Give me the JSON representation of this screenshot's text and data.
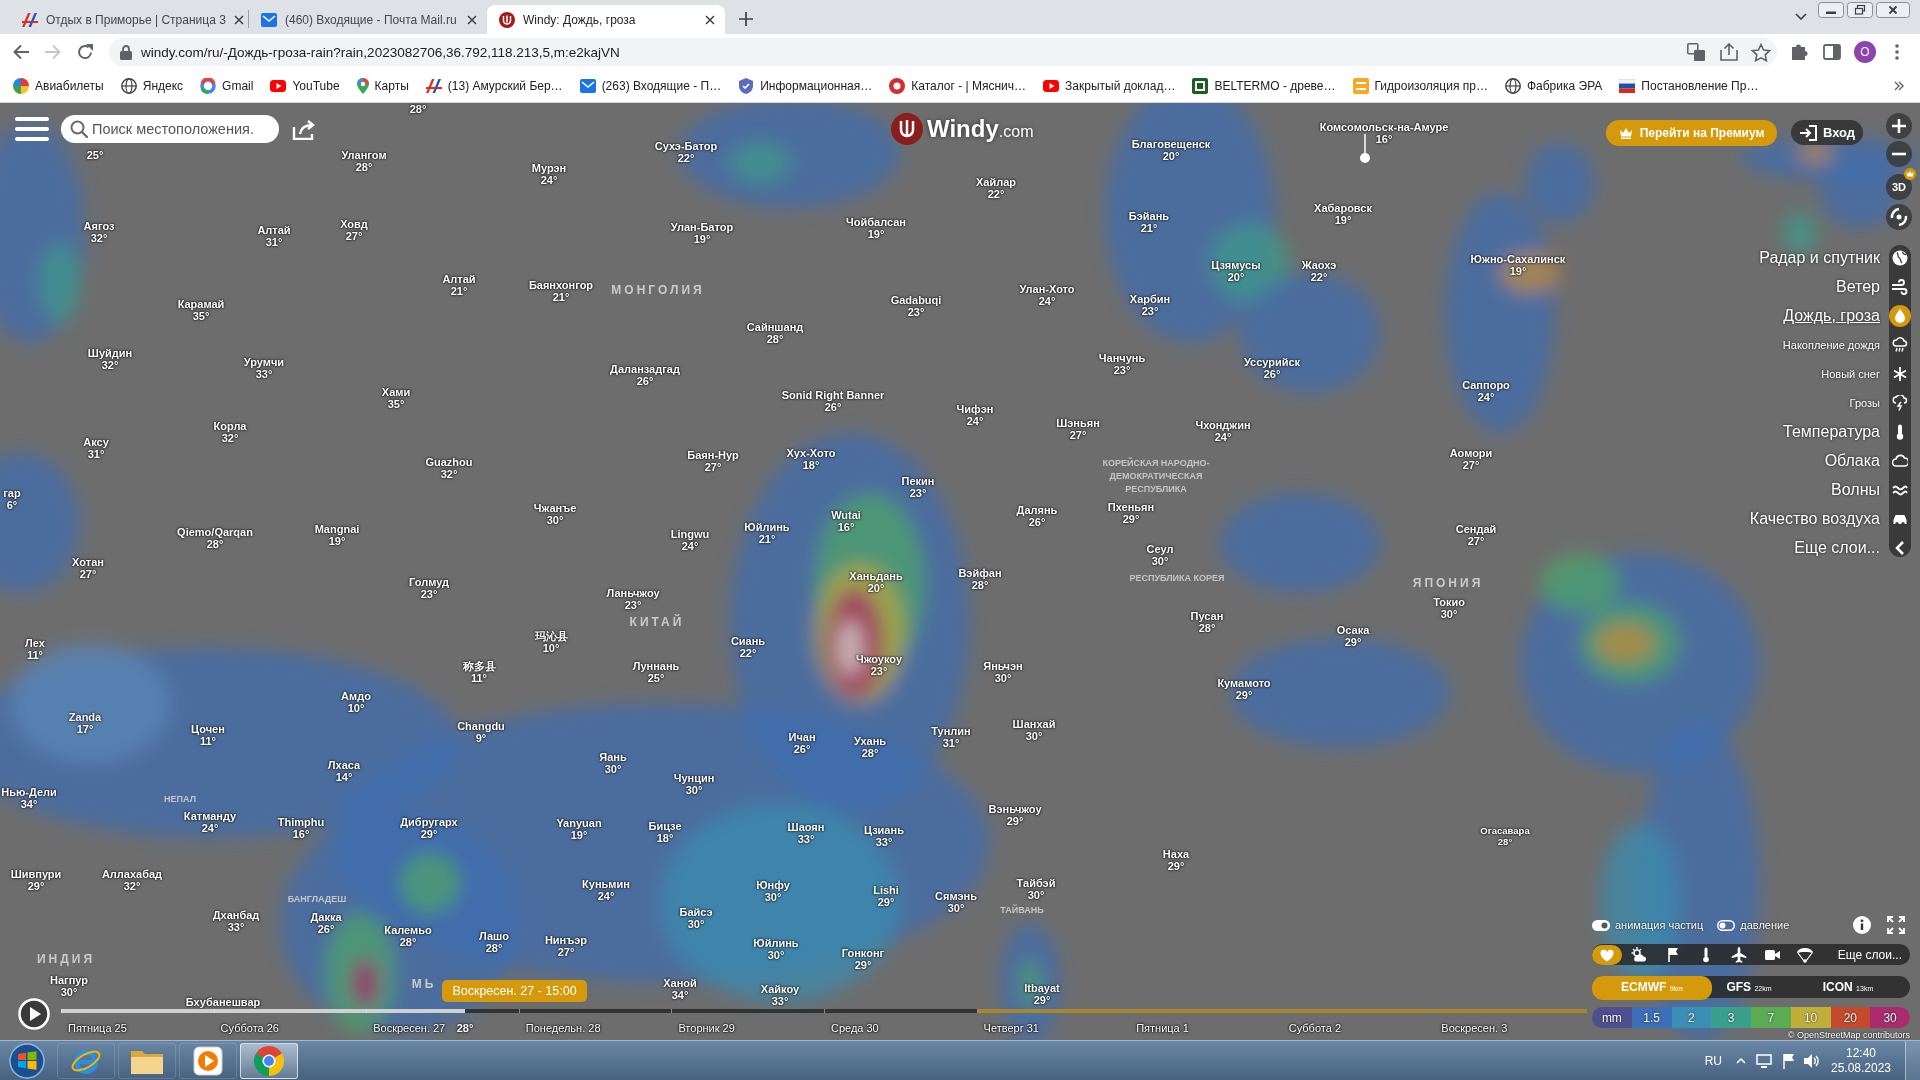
{
  "tabs": [
    {
      "title": "Отдых в Приморье | Страница 3",
      "selected": false
    },
    {
      "title": "(460) Входящие - Почта Mail.ru",
      "selected": false
    },
    {
      "title": "Windy: Дождь, гроза",
      "selected": true
    }
  ],
  "address_bar": {
    "url": "windy.com/ru/-Дождь-гроза-rain?rain,2023082706,36.792,118.213,5,m:e2kajVN",
    "forward_disabled": true,
    "profile_initial": "О"
  },
  "bookmarks": [
    "Авиабилеты",
    "Яндекс",
    "Gmail",
    "YouTube",
    "Карты",
    "(13) Амурский Бер…",
    "(263) Входящие - П…",
    "Информационная…",
    "Каталог - | Мяснич…",
    "Закрытый доклад…",
    "BELTERMO - древе…",
    "Гидроизоляция пр…",
    "Фабрика ЭРА",
    "Постановление Пр…"
  ],
  "map": {
    "search": {
      "placeholder": "Поиск местоположения."
    },
    "logo": {
      "name": "Windy",
      "suffix": ".com"
    },
    "premium_button": "Перейти на Премиум",
    "login_button": "Вход",
    "view_button": "3D",
    "labels": [
      {
        "kind": "city",
        "temp": "28°"
      },
      {
        "kind": "city",
        "name": "Комсомольск-на-Амуре",
        "temp": "16°"
      },
      {
        "kind": "city",
        "temp": "25°"
      },
      {
        "kind": "city",
        "name": "Улангом",
        "temp": "28°"
      },
      {
        "kind": "city",
        "name": "Сухэ-Батор",
        "temp": "22°"
      },
      {
        "kind": "city",
        "name": "Благовещенск",
        "temp": "20°"
      },
      {
        "kind": "city",
        "name": "Мурэн",
        "temp": "24°"
      },
      {
        "kind": "city",
        "name": "Хайлар",
        "temp": "22°"
      },
      {
        "kind": "city",
        "name": "Хабаровск",
        "temp": "19°"
      },
      {
        "kind": "city",
        "name": "Аягоз",
        "temp": "32°"
      },
      {
        "kind": "city",
        "name": "Алтай",
        "temp": "31°"
      },
      {
        "kind": "city",
        "name": "Ховд",
        "temp": "27°"
      },
      {
        "kind": "city",
        "name": "Улан-Батор",
        "temp": "19°"
      },
      {
        "kind": "city",
        "name": "Чойбалсан",
        "temp": "19°"
      },
      {
        "kind": "city",
        "name": "Бэйань",
        "temp": "21°"
      },
      {
        "kind": "city",
        "name": "Цзямусы",
        "temp": "20°"
      },
      {
        "kind": "city",
        "name": "Жаохэ",
        "temp": "22°"
      },
      {
        "kind": "city",
        "name": "Южно-Сахалинск",
        "temp": "19°"
      },
      {
        "kind": "city",
        "name": "Алтай",
        "temp": "21°"
      },
      {
        "kind": "city",
        "name": "Баянхонгор",
        "temp": "21°"
      },
      {
        "kind": "country",
        "name": "МОНГОЛИЯ"
      },
      {
        "kind": "city",
        "name": "Улан-Хото",
        "temp": "24°"
      },
      {
        "kind": "city",
        "name": "Карамай",
        "temp": "35°"
      },
      {
        "kind": "city",
        "name": "Gadabuqi",
        "temp": "23°"
      },
      {
        "kind": "city",
        "name": "Харбин",
        "temp": "23°"
      },
      {
        "kind": "city",
        "name": "Сайншанд",
        "temp": "28°"
      },
      {
        "kind": "city",
        "name": "Шуйдин",
        "temp": "32°"
      },
      {
        "kind": "city",
        "name": "Урумчи",
        "temp": "33°"
      },
      {
        "kind": "city",
        "name": "Даланзадгад",
        "temp": "26°"
      },
      {
        "kind": "city",
        "name": "Чанчунь",
        "temp": "23°"
      },
      {
        "kind": "city",
        "name": "Уссурийск",
        "temp": "26°"
      },
      {
        "kind": "city",
        "name": "Хами",
        "temp": "35°"
      },
      {
        "kind": "city",
        "name": "Sonid Right Banner",
        "temp": "26°"
      },
      {
        "kind": "city",
        "name": "Саппоро",
        "temp": "24°"
      },
      {
        "kind": "city",
        "name": "Чифэн",
        "temp": "24°"
      },
      {
        "kind": "city",
        "name": "Корла",
        "temp": "32°"
      },
      {
        "kind": "city",
        "name": "Шэньян",
        "temp": "27°"
      },
      {
        "kind": "city",
        "name": "Чхонджин",
        "temp": "24°"
      },
      {
        "kind": "city",
        "name": "Аксу",
        "temp": "31°"
      },
      {
        "kind": "city",
        "name": "Guazhou",
        "temp": "32°"
      },
      {
        "kind": "city",
        "name": "Баян-Нур",
        "temp": "27°"
      },
      {
        "kind": "city",
        "name": "Хух-Хото",
        "temp": "18°"
      },
      {
        "kind": "city",
        "name": "гар",
        "temp": "6°"
      },
      {
        "kind": "city",
        "name": "Пекин",
        "temp": "23°"
      },
      {
        "kind": "region",
        "name": "КОРЕЙСКАЯ НАРОДНО-ДЕМОКРАТИЧЕСКАЯ РЕСПУБЛИКА"
      },
      {
        "kind": "city",
        "name": "Аомори",
        "temp": "27°"
      },
      {
        "kind": "city",
        "name": "Чжанъе",
        "temp": "30°"
      },
      {
        "kind": "city",
        "name": "Wutai",
        "temp": "16°"
      },
      {
        "kind": "city",
        "name": "Далянь",
        "temp": "26°"
      },
      {
        "kind": "city",
        "name": "Пхеньян",
        "temp": "29°"
      },
      {
        "kind": "city",
        "name": "Qiemo/Qarqan",
        "temp": "28°"
      },
      {
        "kind": "city",
        "name": "Mangnai",
        "temp": "19°"
      },
      {
        "kind": "city",
        "name": "Lingwu",
        "temp": "24°"
      },
      {
        "kind": "city",
        "name": "Юйлинь",
        "temp": "21°"
      },
      {
        "kind": "city",
        "name": "Сендай",
        "temp": "27°"
      },
      {
        "kind": "city",
        "name": "Хотан",
        "temp": "27°"
      },
      {
        "kind": "city",
        "name": "Сеул",
        "temp": "30°"
      },
      {
        "kind": "city",
        "name": "Голмуд",
        "temp": "23°"
      },
      {
        "kind": "city",
        "name": "Ханьдань",
        "temp": "20°"
      },
      {
        "kind": "city",
        "name": "Вэйфан",
        "temp": "28°"
      },
      {
        "kind": "region",
        "name": "РЕСПУБЛИКА КОРЕЯ"
      },
      {
        "kind": "country",
        "name": "ЯПОНИЯ"
      },
      {
        "kind": "city",
        "name": "Ланьчжоу",
        "temp": "23°"
      },
      {
        "kind": "city",
        "name": "Токио",
        "temp": "30°"
      },
      {
        "kind": "city",
        "name": "Лех",
        "temp": "11°"
      },
      {
        "kind": "city",
        "name": "玛沁县",
        "temp": "10°"
      },
      {
        "kind": "country",
        "name": "КИТАЙ"
      },
      {
        "kind": "city",
        "name": "Сиань",
        "temp": "22°"
      },
      {
        "kind": "city",
        "name": "Пусан",
        "temp": "28°"
      },
      {
        "kind": "city",
        "name": "Осака",
        "temp": "29°"
      },
      {
        "kind": "city",
        "name": "称多县",
        "temp": "11°"
      },
      {
        "kind": "city",
        "name": "Луннань",
        "temp": "25°"
      },
      {
        "kind": "city",
        "name": "Чжоукоу",
        "temp": "23°"
      },
      {
        "kind": "city",
        "name": "Яньчэн",
        "temp": "30°"
      },
      {
        "kind": "city",
        "name": "Амдо",
        "temp": "10°"
      },
      {
        "kind": "city",
        "name": "Кумамото",
        "temp": "29°"
      },
      {
        "kind": "city",
        "name": "Zanda",
        "temp": "17°"
      },
      {
        "kind": "city",
        "name": "Цочен",
        "temp": "11°"
      },
      {
        "kind": "city",
        "name": "Changdu",
        "temp": "9°"
      },
      {
        "kind": "city",
        "name": "Ичан",
        "temp": "26°"
      },
      {
        "kind": "city",
        "name": "Ухань",
        "temp": "28°"
      },
      {
        "kind": "city",
        "name": "Тунлин",
        "temp": "31°"
      },
      {
        "kind": "city",
        "name": "Шанхай",
        "temp": "30°"
      },
      {
        "kind": "city",
        "name": "Лхаса",
        "temp": "14°"
      },
      {
        "kind": "city",
        "name": "Яань",
        "temp": "30°"
      },
      {
        "kind": "city",
        "name": "Нью-Дели",
        "temp": "34°"
      },
      {
        "kind": "region",
        "name": "НЕПАЛ"
      },
      {
        "kind": "city",
        "name": "Чунцин",
        "temp": "30°"
      },
      {
        "kind": "city",
        "name": "Катманду",
        "temp": "24°"
      },
      {
        "kind": "city",
        "name": "Thimphu",
        "temp": "16°"
      },
      {
        "kind": "city",
        "name": "Дибругарх",
        "temp": "29°"
      },
      {
        "kind": "city",
        "name": "Yanyuan",
        "temp": "19°"
      },
      {
        "kind": "city",
        "name": "Бицзе",
        "temp": "18°"
      },
      {
        "kind": "city",
        "name": "Шаоян",
        "temp": "33°"
      },
      {
        "kind": "city",
        "name": "Цзиань",
        "temp": "33°"
      },
      {
        "kind": "city",
        "name": "Вэньчжоу",
        "temp": "29°"
      },
      {
        "kind": "minor",
        "name": "Огасавара",
        "temp": "28°"
      },
      {
        "kind": "city",
        "name": "Наха",
        "temp": "29°"
      },
      {
        "kind": "city",
        "name": "Шивпури",
        "temp": "29°"
      },
      {
        "kind": "city",
        "name": "Аллахабад",
        "temp": "32°"
      },
      {
        "kind": "region",
        "name": "БАНГЛАДЕШ"
      },
      {
        "kind": "city",
        "name": "Куньмин",
        "temp": "24°"
      },
      {
        "kind": "city",
        "name": "Юнфу",
        "temp": "30°"
      },
      {
        "kind": "city",
        "name": "Lishi",
        "temp": "29°"
      },
      {
        "kind": "city",
        "name": "Сямэнь",
        "temp": "30°"
      },
      {
        "kind": "city",
        "name": "Тайбэй",
        "temp": "30°"
      },
      {
        "kind": "city",
        "name": "Дханбад",
        "temp": "33°"
      },
      {
        "kind": "city",
        "name": "Дакка",
        "temp": "26°"
      },
      {
        "kind": "city",
        "name": "Байсэ",
        "temp": "30°"
      },
      {
        "kind": "region",
        "name": "ТАЙВАНЬ"
      },
      {
        "kind": "country",
        "name": "ИНДИЯ"
      },
      {
        "kind": "city",
        "name": "Калемьо",
        "temp": "28°"
      },
      {
        "kind": "city",
        "name": "Лашо",
        "temp": "28°"
      },
      {
        "kind": "city",
        "name": "Нинъэр",
        "temp": "27°"
      },
      {
        "kind": "city",
        "name": "Юйлинь",
        "temp": "30°"
      },
      {
        "kind": "city",
        "name": "Гонконг",
        "temp": "29°"
      },
      {
        "kind": "city",
        "name": "Нагпур",
        "temp": "30°"
      },
      {
        "kind": "city",
        "name": "Бхубанешвар"
      },
      {
        "kind": "country",
        "name": "МЬ"
      },
      {
        "kind": "city",
        "name": "Ханой",
        "temp": "34°"
      },
      {
        "kind": "city",
        "name": "Хайкоу",
        "temp": "33°"
      },
      {
        "kind": "city",
        "name": "Itbayat",
        "temp": "29°"
      },
      {
        "kind": "city",
        "temp": "28°"
      }
    ],
    "layers": [
      {
        "label": "Радар и спутник",
        "kind": "main",
        "selected": false
      },
      {
        "label": "Ветер",
        "kind": "main",
        "selected": false
      },
      {
        "label": "Дождь, гроза",
        "kind": "main",
        "selected": true
      },
      {
        "label": "Накопление дождя",
        "kind": "sub",
        "selected": false
      },
      {
        "label": "Новый снег",
        "kind": "sub",
        "selected": false
      },
      {
        "label": "Грозы",
        "kind": "sub",
        "selected": false
      },
      {
        "label": "Температура",
        "kind": "main",
        "selected": false
      },
      {
        "label": "Облака",
        "kind": "main",
        "selected": false
      },
      {
        "label": "Волны",
        "kind": "main",
        "selected": false
      },
      {
        "label": "Качество воздуха",
        "kind": "main",
        "selected": false
      },
      {
        "label": "Еще слои...",
        "kind": "main",
        "selected": false
      }
    ],
    "toggles": [
      {
        "label": "анимация частиц",
        "on": true
      },
      {
        "label": "давление",
        "on": false
      }
    ],
    "favorites": [
      {
        "selected": true
      },
      {
        "selected": false
      },
      {
        "selected": false
      },
      {
        "selected": false
      },
      {
        "selected": false
      },
      {
        "selected": false
      },
      {
        "selected": false
      }
    ],
    "favorites_more": "Еще слои...",
    "models": [
      {
        "name": "ECMWF",
        "resolution": "9km",
        "selected": true
      },
      {
        "name": "GFS",
        "resolution": "22km",
        "selected": false
      },
      {
        "name": "ICON",
        "resolution": "13km",
        "selected": false
      }
    ],
    "legend": {
      "stops": [
        {
          "value": "mm",
          "color": "#4e4f8f"
        },
        {
          "value": "1.5",
          "color": "#3d6fb6"
        },
        {
          "value": "2",
          "color": "#3a8fb6"
        },
        {
          "value": "3",
          "color": "#3aa08c"
        },
        {
          "value": "7",
          "color": "#5aab52"
        },
        {
          "value": "10",
          "color": "#bfae37"
        },
        {
          "value": "20",
          "color": "#c54a2c"
        },
        {
          "value": "30",
          "color": "#a82c6e"
        }
      ]
    },
    "attribution": "© OpenStreetMap contributors"
  },
  "timeline": {
    "current": "Воскресен. 27 - 15:00",
    "level": 0.265,
    "days": [
      {
        "label": "Пятница 25",
        "premium": false
      },
      {
        "label": "Суббота 26",
        "premium": false
      },
      {
        "label": "Воскресен. 27",
        "premium": false
      },
      {
        "label": "Понедельн. 28",
        "premium": false
      },
      {
        "label": "Вторник 29",
        "premium": false
      },
      {
        "label": "Среда 30",
        "premium": false
      },
      {
        "label": "Четверг 31",
        "premium": true
      },
      {
        "label": "Пятница 1",
        "premium": true
      },
      {
        "label": "Суббота 2",
        "premium": true
      },
      {
        "label": "Воскресен. 3",
        "premium": true
      }
    ]
  },
  "taskbar": {
    "apps": [
      {
        "selected": false
      },
      {
        "selected": false
      },
      {
        "selected": false
      },
      {
        "selected": true
      }
    ],
    "language": "RU",
    "time": "12:40",
    "date": "25.08.2023"
  }
}
